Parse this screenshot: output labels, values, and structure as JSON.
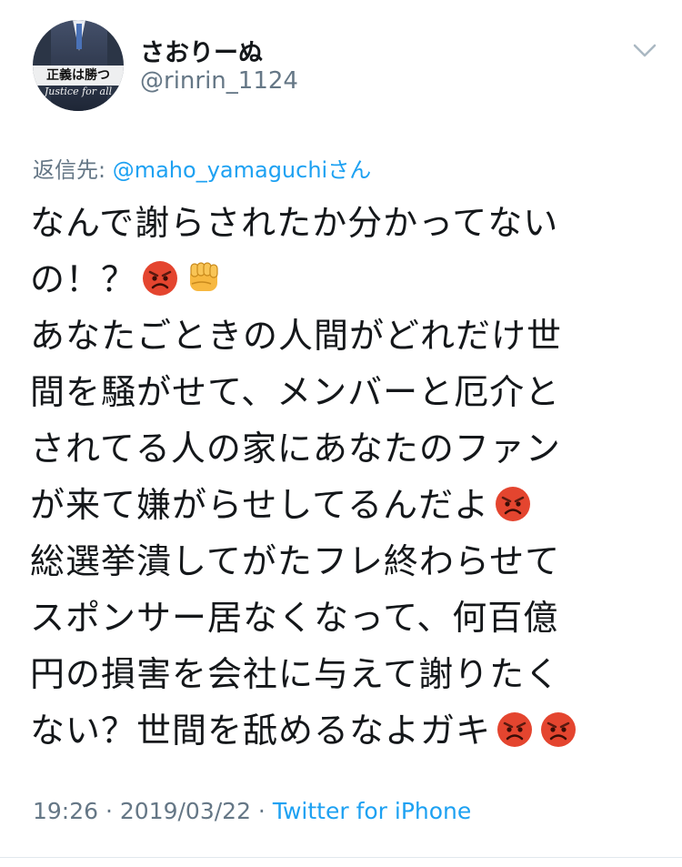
{
  "author": {
    "avatar_banner": "正義は勝つ",
    "avatar_subtitle": "Justice for all",
    "display_name": "さおりーぬ",
    "handle": "@rinrin_1124"
  },
  "reply": {
    "label": "返信先: ",
    "mention": "@maho_yamaguchi",
    "suffix": "さん"
  },
  "tweet": {
    "line1": "なんで謝らされたか分かってない",
    "line2": "の！？",
    "line3": "あなたごときの人間がどれだけ世",
    "line4": "間を騒がせて、メンバーと厄介と",
    "line5": "されてる人の家にあなたのファン",
    "line6": "が来て嫌がらせしてるんだよ",
    "line7": "総選挙潰してがたフレ終わらせて",
    "line8": "スポンサー居なくなって、何百億",
    "line9": "円の損害を会社に与えて謝りたく",
    "line10": "ない？世間を舐めるなよガキ"
  },
  "meta": {
    "time": "19:26",
    "sep1": " · ",
    "date": "2019/03/22",
    "sep2": " · ",
    "source": "Twitter for iPhone"
  },
  "icons": {
    "menu": "chevron-down-icon",
    "angry": "angry-face-icon",
    "fist": "oncoming-fist-icon"
  },
  "colors": {
    "text": "#14171a",
    "muted": "#657786",
    "link": "#1da1f2",
    "angry_face": "#e4452f",
    "fist": "#f7b840"
  }
}
